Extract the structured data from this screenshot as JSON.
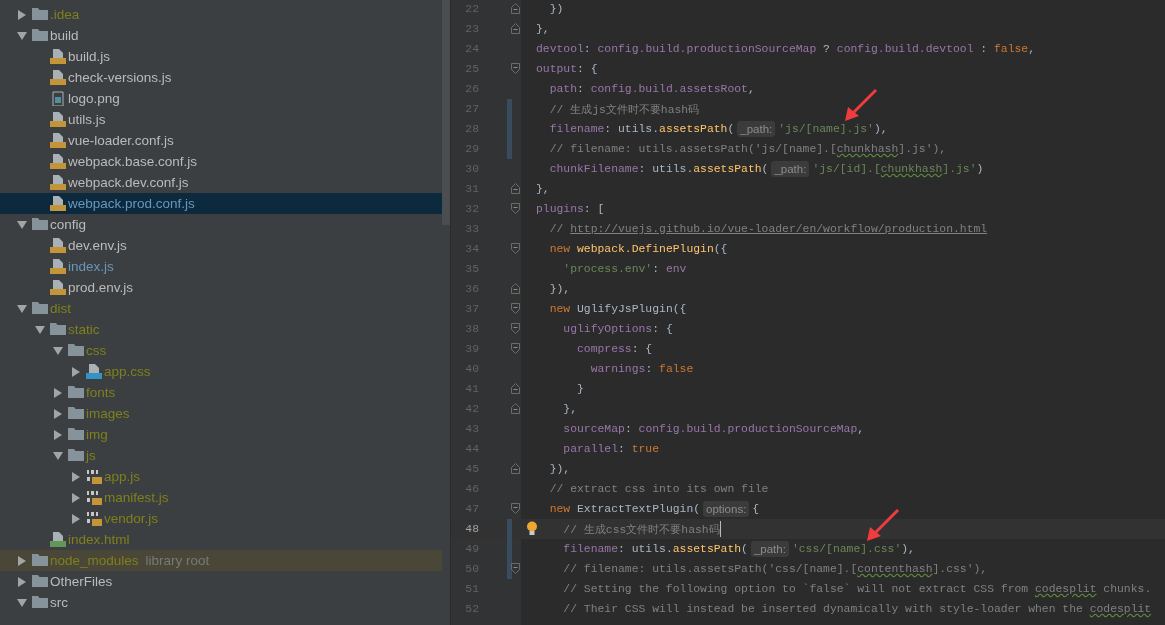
{
  "project_tree": [
    {
      "name": ".idea",
      "kind": "folder",
      "excluded": true,
      "expanded": false,
      "selected": false
    },
    {
      "name": "build",
      "kind": "folder",
      "expanded": true,
      "selected": false,
      "children": [
        {
          "name": "build.js",
          "kind": "js",
          "selected": false
        },
        {
          "name": "check-versions.js",
          "kind": "js",
          "selected": false
        },
        {
          "name": "logo.png",
          "kind": "image",
          "selected": false
        },
        {
          "name": "utils.js",
          "kind": "js",
          "selected": false
        },
        {
          "name": "vue-loader.conf.js",
          "kind": "js",
          "selected": false
        },
        {
          "name": "webpack.base.conf.js",
          "kind": "js",
          "selected": false
        },
        {
          "name": "webpack.dev.conf.js",
          "kind": "js",
          "selected": false
        },
        {
          "name": "webpack.prod.conf.js",
          "kind": "js",
          "modified": true,
          "selected": true
        }
      ]
    },
    {
      "name": "config",
      "kind": "folder",
      "expanded": true,
      "selected": false,
      "children": [
        {
          "name": "dev.env.js",
          "kind": "js",
          "selected": false
        },
        {
          "name": "index.js",
          "kind": "js",
          "modified": true,
          "selected": false
        },
        {
          "name": "prod.env.js",
          "kind": "js",
          "selected": false
        }
      ]
    },
    {
      "name": "dist",
      "kind": "folder",
      "excluded": true,
      "expanded": true,
      "selected": false,
      "children": [
        {
          "name": "static",
          "kind": "folder",
          "excluded": true,
          "expanded": true,
          "selected": false,
          "children": [
            {
              "name": "css",
              "kind": "folder",
              "excluded": true,
              "expanded": true,
              "selected": false,
              "children": [
                {
                  "name": "app.css",
                  "kind": "css",
                  "excluded": true,
                  "expanded": false,
                  "selected": false
                }
              ]
            },
            {
              "name": "fonts",
              "kind": "folder",
              "excluded": true,
              "expanded": false,
              "selected": false
            },
            {
              "name": "images",
              "kind": "folder",
              "excluded": true,
              "expanded": false,
              "selected": false
            },
            {
              "name": "img",
              "kind": "folder",
              "excluded": true,
              "expanded": false,
              "selected": false
            },
            {
              "name": "js",
              "kind": "folder",
              "excluded": true,
              "expanded": true,
              "selected": false,
              "children": [
                {
                  "name": "app.js",
                  "kind": "bundle",
                  "excluded": true,
                  "expanded": false,
                  "selected": false
                },
                {
                  "name": "manifest.js",
                  "kind": "bundle",
                  "excluded": true,
                  "expanded": false,
                  "selected": false
                },
                {
                  "name": "vendor.js",
                  "kind": "bundle",
                  "excluded": true,
                  "expanded": false,
                  "selected": false
                }
              ]
            }
          ]
        },
        {
          "name": "index.html",
          "kind": "html",
          "excluded": true,
          "selected": false
        }
      ]
    },
    {
      "name": "node_modules",
      "kind": "folder",
      "excluded": true,
      "expanded": false,
      "selected": false,
      "highlighted": true,
      "note": "library root"
    },
    {
      "name": "OtherFiles",
      "kind": "folder",
      "expanded": false,
      "selected": false
    },
    {
      "name": "src",
      "kind": "folder",
      "expanded": true,
      "selected": false
    }
  ],
  "editor": {
    "lines": [
      {
        "number": "22",
        "fold_end": true,
        "tokens": [
          {
            "kind": "plain",
            "text": "  })"
          }
        ]
      },
      {
        "number": "23",
        "fold_end": true,
        "tokens": [
          {
            "kind": "plain",
            "text": "},"
          }
        ]
      },
      {
        "number": "24",
        "tokens": [
          {
            "kind": "prop",
            "text": "devtool"
          },
          {
            "kind": "plain",
            "text": ": "
          },
          {
            "kind": "prop",
            "text": "config.build.productionSourceMap"
          },
          {
            "kind": "plain",
            "text": " ? "
          },
          {
            "kind": "prop",
            "text": "config.build.devtool"
          },
          {
            "kind": "plain",
            "text": " : "
          },
          {
            "kind": "keyword",
            "text": "false"
          },
          {
            "kind": "plain",
            "text": ","
          }
        ]
      },
      {
        "number": "25",
        "fold_start": true,
        "tokens": [
          {
            "kind": "prop",
            "text": "output"
          },
          {
            "kind": "plain",
            "text": ": {"
          }
        ]
      },
      {
        "number": "26",
        "tokens": [
          {
            "kind": "prop",
            "text": "  path"
          },
          {
            "kind": "plain",
            "text": ": "
          },
          {
            "kind": "prop",
            "text": "config.build.assetsRoot"
          },
          {
            "kind": "plain",
            "text": ","
          }
        ]
      },
      {
        "number": "27",
        "changed": true,
        "arrow": true,
        "tokens": [
          {
            "kind": "comment",
            "text": "  // 生成js文件时不要hash码"
          }
        ]
      },
      {
        "number": "28",
        "changed": true,
        "tokens": [
          {
            "kind": "prop",
            "text": "  filename"
          },
          {
            "kind": "plain",
            "text": ": utils."
          },
          {
            "kind": "function",
            "text": "assetsPath"
          },
          {
            "kind": "plain",
            "text": "("
          },
          {
            "kind": "hint",
            "text": "_path:"
          },
          {
            "kind": "string",
            "text": "'js/[name].js'"
          },
          {
            "kind": "plain",
            "text": "),"
          }
        ]
      },
      {
        "number": "29",
        "changed": true,
        "tokens": [
          {
            "kind": "comment",
            "text": "  // filename: utils.assetsPath('js/[name].["
          },
          {
            "kind": "comment-typo",
            "text": "chunkhash"
          },
          {
            "kind": "comment",
            "text": "].js'),"
          }
        ]
      },
      {
        "number": "30",
        "tokens": [
          {
            "kind": "prop",
            "text": "  chunkFilename"
          },
          {
            "kind": "plain",
            "text": ": utils."
          },
          {
            "kind": "function",
            "text": "assetsPath"
          },
          {
            "kind": "plain",
            "text": "("
          },
          {
            "kind": "hint",
            "text": "_path:"
          },
          {
            "kind": "string",
            "text": "'js/[id].["
          },
          {
            "kind": "string-typo",
            "text": "chunkhash"
          },
          {
            "kind": "string",
            "text": "].js'"
          },
          {
            "kind": "plain",
            "text": ")"
          }
        ]
      },
      {
        "number": "31",
        "fold_end": true,
        "tokens": [
          {
            "kind": "plain",
            "text": "},"
          }
        ]
      },
      {
        "number": "32",
        "fold_start": true,
        "tokens": [
          {
            "kind": "prop",
            "text": "plugins"
          },
          {
            "kind": "plain",
            "text": ": ["
          }
        ]
      },
      {
        "number": "33",
        "tokens": [
          {
            "kind": "comment",
            "text": "  // "
          },
          {
            "kind": "link",
            "text": "http://vuejs.github.io/vue-loader/en/workflow/production.html"
          }
        ]
      },
      {
        "number": "34",
        "fold_start": true,
        "tokens": [
          {
            "kind": "keyword",
            "text": "  new "
          },
          {
            "kind": "function",
            "text": "webpack.DefinePlugin"
          },
          {
            "kind": "plain",
            "text": "({"
          }
        ]
      },
      {
        "number": "35",
        "tokens": [
          {
            "kind": "string",
            "text": "    'process.env'"
          },
          {
            "kind": "plain",
            "text": ": "
          },
          {
            "kind": "prop",
            "text": "env"
          }
        ]
      },
      {
        "number": "36",
        "fold_end": true,
        "tokens": [
          {
            "kind": "plain",
            "text": "  }),"
          }
        ]
      },
      {
        "number": "37",
        "fold_start": true,
        "tokens": [
          {
            "kind": "keyword",
            "text": "  new "
          },
          {
            "kind": "plain",
            "text": "UglifyJsPlugin({"
          }
        ]
      },
      {
        "number": "38",
        "fold_start": true,
        "tokens": [
          {
            "kind": "prop",
            "text": "    uglifyOptions"
          },
          {
            "kind": "plain",
            "text": ": {"
          }
        ]
      },
      {
        "number": "39",
        "fold_start": true,
        "tokens": [
          {
            "kind": "prop",
            "text": "      compress"
          },
          {
            "kind": "plain",
            "text": ": {"
          }
        ]
      },
      {
        "number": "40",
        "tokens": [
          {
            "kind": "prop",
            "text": "        warnings"
          },
          {
            "kind": "plain",
            "text": ": "
          },
          {
            "kind": "keyword",
            "text": "false"
          }
        ]
      },
      {
        "number": "41",
        "fold_end": true,
        "tokens": [
          {
            "kind": "plain",
            "text": "      }"
          }
        ]
      },
      {
        "number": "42",
        "fold_end": true,
        "tokens": [
          {
            "kind": "plain",
            "text": "    },"
          }
        ]
      },
      {
        "number": "43",
        "tokens": [
          {
            "kind": "prop",
            "text": "    sourceMap"
          },
          {
            "kind": "plain",
            "text": ": "
          },
          {
            "kind": "prop",
            "text": "config.build.productionSourceMap"
          },
          {
            "kind": "plain",
            "text": ","
          }
        ]
      },
      {
        "number": "44",
        "tokens": [
          {
            "kind": "prop",
            "text": "    parallel"
          },
          {
            "kind": "plain",
            "text": ": "
          },
          {
            "kind": "keyword",
            "text": "true"
          }
        ]
      },
      {
        "number": "45",
        "fold_end": true,
        "tokens": [
          {
            "kind": "plain",
            "text": "  }),"
          }
        ]
      },
      {
        "number": "46",
        "tokens": [
          {
            "kind": "comment",
            "text": "  // extract css into its own file"
          }
        ]
      },
      {
        "number": "47",
        "fold_start": true,
        "tokens": [
          {
            "kind": "keyword",
            "text": "  new "
          },
          {
            "kind": "plain",
            "text": "ExtractTextPlugin("
          },
          {
            "kind": "hint",
            "text": "options:"
          },
          {
            "kind": "plain",
            "text": "{"
          }
        ]
      },
      {
        "number": "48",
        "changed": true,
        "current": true,
        "bulb": true,
        "caret": true,
        "arrow": true,
        "tokens": [
          {
            "kind": "comment",
            "text": "    // 生成css文件时不要hash码"
          }
        ]
      },
      {
        "number": "49",
        "changed": true,
        "tokens": [
          {
            "kind": "prop",
            "text": "    filename"
          },
          {
            "kind": "plain",
            "text": ": utils."
          },
          {
            "kind": "function",
            "text": "assetsPath"
          },
          {
            "kind": "plain",
            "text": "("
          },
          {
            "kind": "hint",
            "text": "_path:"
          },
          {
            "kind": "string",
            "text": "'css/[name].css'"
          },
          {
            "kind": "plain",
            "text": "),"
          }
        ]
      },
      {
        "number": "50",
        "changed": true,
        "fold_start": true,
        "tokens": [
          {
            "kind": "comment",
            "text": "    // filename: utils.assetsPath('css/[name].["
          },
          {
            "kind": "comment-typo",
            "text": "contenthash"
          },
          {
            "kind": "comment",
            "text": "].css'),"
          }
        ]
      },
      {
        "number": "51",
        "tokens": [
          {
            "kind": "comment",
            "text": "    // Setting the following option to `false` will not extract CSS from "
          },
          {
            "kind": "comment-typo",
            "text": "codesplit"
          },
          {
            "kind": "comment",
            "text": " chunks."
          }
        ]
      },
      {
        "number": "52",
        "tokens": [
          {
            "kind": "comment",
            "text": "    // Their CSS will instead be inserted dynamically with style-loader when the "
          },
          {
            "kind": "comment-typo",
            "text": "codesplit"
          }
        ]
      }
    ]
  }
}
